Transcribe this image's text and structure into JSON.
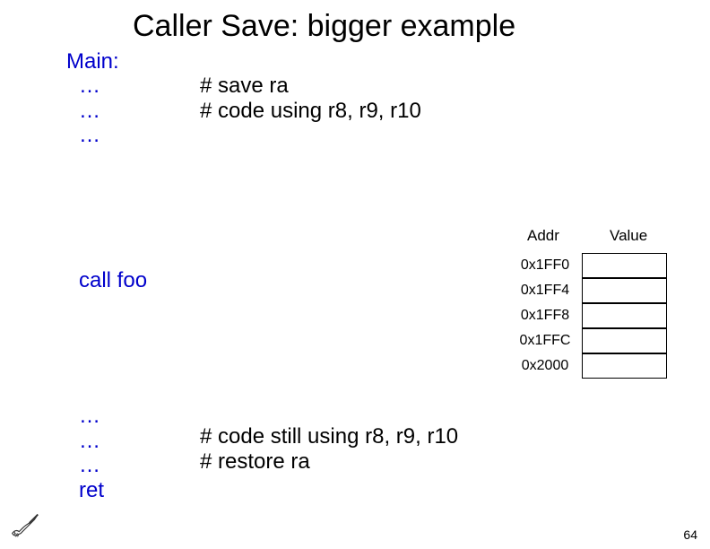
{
  "title": "Caller Save: bigger example",
  "main_label": "Main:",
  "code1": {
    "l1": "…",
    "l2": "…",
    "l3": "…"
  },
  "comment1": {
    "l1": "# save ra",
    "l2": "# code using r8, r9, r10"
  },
  "call_foo": "call foo",
  "code2": {
    "l1": "…",
    "l2": "…",
    "l3": "…",
    "l4": "ret"
  },
  "comment2": {
    "l1": "# code still using r8, r9, r10",
    "l2": "# restore ra"
  },
  "table": {
    "addr_header": "Addr",
    "value_header": "Value",
    "rows": [
      {
        "addr": "0x1FF0",
        "value": ""
      },
      {
        "addr": "0x1FF4",
        "value": ""
      },
      {
        "addr": "0x1FF8",
        "value": ""
      },
      {
        "addr": "0x1FFC",
        "value": ""
      },
      {
        "addr": "0x2000",
        "value": ""
      }
    ]
  },
  "page_number": "64"
}
